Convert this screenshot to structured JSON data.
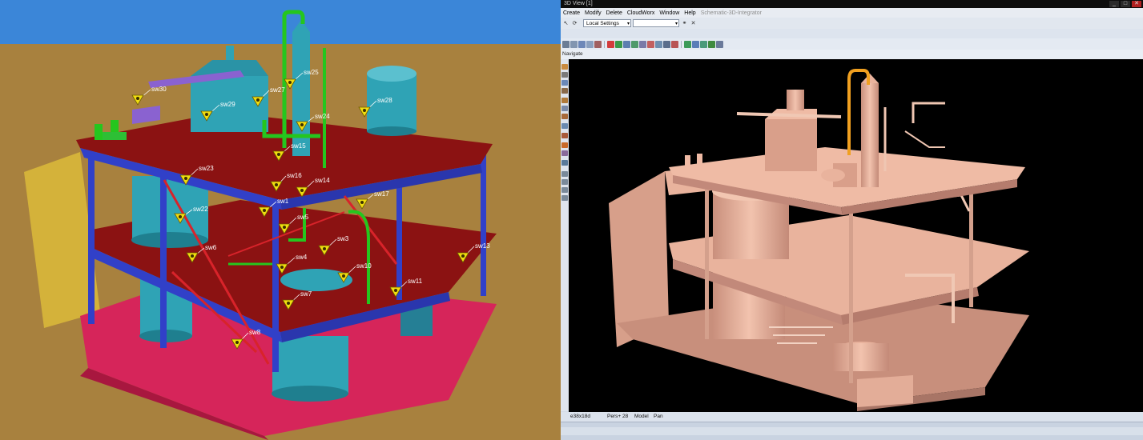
{
  "left_view": {
    "tags": [
      {
        "id": "sw30",
        "label": "sw30"
      },
      {
        "id": "sw29",
        "label": "sw29"
      },
      {
        "id": "sw27",
        "label": "sw27"
      },
      {
        "id": "sw25",
        "label": "sw25"
      },
      {
        "id": "sw28",
        "label": "sw28"
      },
      {
        "id": "sw24",
        "label": "sw24"
      },
      {
        "id": "sw15",
        "label": "sw15"
      },
      {
        "id": "sw16",
        "label": "sw16"
      },
      {
        "id": "sw14",
        "label": "sw14"
      },
      {
        "id": "sw23",
        "label": "sw23"
      },
      {
        "id": "sw22",
        "label": "sw22"
      },
      {
        "id": "sw1",
        "label": "sw1"
      },
      {
        "id": "sw5",
        "label": "sw5"
      },
      {
        "id": "sw17",
        "label": "sw17"
      },
      {
        "id": "sw3",
        "label": "sw3"
      },
      {
        "id": "sw6",
        "label": "sw6"
      },
      {
        "id": "sw4",
        "label": "sw4"
      },
      {
        "id": "sw10",
        "label": "sw10"
      },
      {
        "id": "sw13",
        "label": "sw13"
      },
      {
        "id": "sw11",
        "label": "sw11"
      },
      {
        "id": "sw7",
        "label": "sw7"
      },
      {
        "id": "sw8",
        "label": "sw8"
      }
    ],
    "colors": {
      "sky": "#3b86d8",
      "ground": "#a8813e",
      "deck": "#8b1212",
      "beam": "#3140c8",
      "tank": "#2fa3b5",
      "pipe": "#25c61e",
      "base": "#d6255a",
      "wall": "#d4b23a",
      "tag": "#f0dd10"
    }
  },
  "app": {
    "title": "3D View [1]",
    "window_buttons": [
      "_",
      "□",
      "✕"
    ],
    "menu": [
      "Create",
      "Modify",
      "Delete",
      "CloudWorx",
      "Window",
      "Help"
    ],
    "menu_dim": "Schematic-3D-Integrator",
    "settings_combo": "Local Settings",
    "navigate_label": "Navigate",
    "status": {
      "coords": "e38x18d",
      "projection": "Pers+ 28",
      "mode": "Model",
      "tool": "Pan"
    },
    "colors": {
      "model": "#e9b39d",
      "background": "#000000",
      "highlight": "#f0a020"
    }
  }
}
